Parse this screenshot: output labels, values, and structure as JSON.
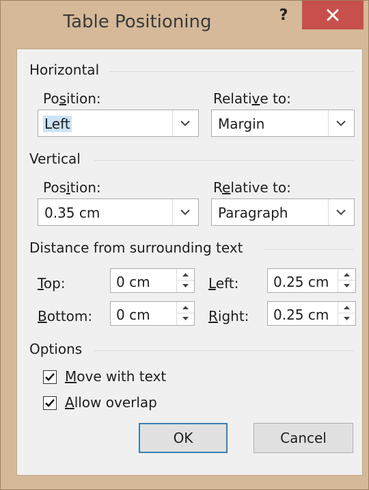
{
  "dialog": {
    "title": "Table Positioning",
    "help_label": "?"
  },
  "horizontal": {
    "group_label": "Horizontal",
    "position": {
      "label_pre": "Po",
      "label_u": "s",
      "label_post": "ition:",
      "value": "Left"
    },
    "relative_to": {
      "label_pre": "Relati",
      "label_u": "v",
      "label_post": "e to:",
      "value": "Margin"
    }
  },
  "vertical": {
    "group_label": "Vertical",
    "position": {
      "label_pre": "Pos",
      "label_u": "i",
      "label_post": "tion:",
      "value": "0.35 cm"
    },
    "relative_to": {
      "label_pre": "R",
      "label_u": "e",
      "label_post": "lative to:",
      "value": "Paragraph"
    }
  },
  "distance": {
    "group_label": "Distance from surrounding text",
    "top": {
      "label_u": "T",
      "label_post": "op:",
      "value": "0 cm"
    },
    "bottom": {
      "label_u": "B",
      "label_post": "ottom:",
      "value": "0 cm"
    },
    "left": {
      "label_u": "L",
      "label_post": "eft:",
      "value": "0.25 cm"
    },
    "right": {
      "label_u": "R",
      "label_post": "ight:",
      "value": "0.25 cm"
    }
  },
  "options": {
    "group_label": "Options",
    "move_with_text": {
      "label_u": "M",
      "label_post": "ove with text",
      "checked": true
    },
    "allow_overlap": {
      "label_u": "A",
      "label_post": "llow overlap",
      "checked": true
    }
  },
  "buttons": {
    "ok": "OK",
    "cancel": "Cancel"
  },
  "colors": {
    "frame": "#d5b998",
    "close_button": "#c7504c",
    "client": "#f0f0f0",
    "selection_highlight": "#cce4f7",
    "default_button_border": "#3c7fb1"
  },
  "icons": {
    "close": "close-icon",
    "dropdown": "chevron-down-icon",
    "spin_up": "spin-up-icon",
    "spin_down": "spin-down-icon",
    "check": "checkmark-icon"
  }
}
